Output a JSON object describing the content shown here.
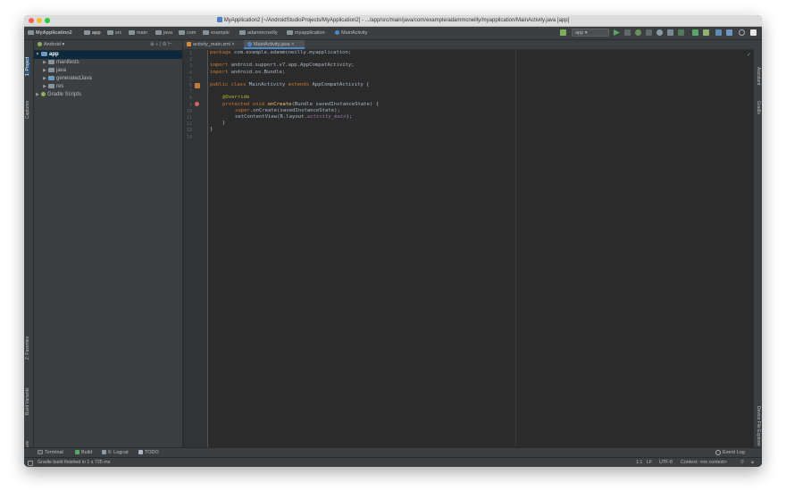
{
  "window": {
    "title": "MyApplication2 [~/AndroidStudioProjects/MyApplication2] - .../app/src/main/java/com/example/adammcneilly/myapplication/MainActivity.java [app]"
  },
  "breadcrumbs": [
    "MyApplication2",
    "app",
    "src",
    "main",
    "java",
    "com",
    "example",
    "adammcneilly",
    "myapplication",
    "MainActivity"
  ],
  "toolbar": {
    "run_config": "app"
  },
  "left_tabs": [
    "1: Project",
    "Captures",
    "2: Favorites",
    "Build Variants",
    "Z: Structure"
  ],
  "right_tabs": [
    "Assistant",
    "Gradle",
    "Device File Explorer"
  ],
  "project": {
    "view_selector": "Android",
    "tree": [
      {
        "label": "app",
        "level": 0,
        "expanded": true
      },
      {
        "label": "manifests",
        "level": 1,
        "expanded": false
      },
      {
        "label": "java",
        "level": 1,
        "expanded": false
      },
      {
        "label": "generatedJava",
        "level": 1,
        "expanded": false
      },
      {
        "label": "res",
        "level": 1,
        "expanded": false
      },
      {
        "label": "Gradle Scripts",
        "level": 0,
        "expanded": false
      }
    ]
  },
  "editor": {
    "tabs": [
      {
        "label": "activity_main.xml",
        "active": false
      },
      {
        "label": "MainActivity.java",
        "active": true
      }
    ],
    "line_numbers": [
      "1",
      "2",
      "3",
      "4",
      "5",
      "6",
      "7",
      "8",
      "9",
      "10",
      "11",
      "12",
      "13",
      "14"
    ],
    "code": {
      "l1_kw": "package",
      "l1_rest": " com.example.adammcneilly.myapplication;",
      "l3_kw": "import",
      "l3_rest": " android.support.v7.app.AppCompatActivity;",
      "l4_kw": "import",
      "l4_rest": " android.os.Bundle;",
      "l6_kw": "public class",
      "l6_name": " MainActivity ",
      "l6_kw2": "extends",
      "l6_rest": " AppCompatActivity {",
      "l8_an": "@Override",
      "l9_kw": "protected void",
      "l9_mt": " onCreate",
      "l9_rest": "(Bundle savedInstanceState) {",
      "l10_kw": "super",
      "l10_rest": ".onCreate(savedInstanceState);",
      "l11_a": "setContentView(R.layout.",
      "l11_fd": "activity_main",
      "l11_b": ");",
      "l12": "}",
      "l13": "}"
    }
  },
  "bottom_tabs": [
    "Terminal",
    "Build",
    "6: Logcat",
    "TODO"
  ],
  "event_log": "Event Log",
  "status": {
    "message": "Gradle build finished in 1 s 725 ms",
    "position": "1:1",
    "line_sep": "LF",
    "encoding": "UTF-8",
    "context": "Context: <no context>"
  }
}
